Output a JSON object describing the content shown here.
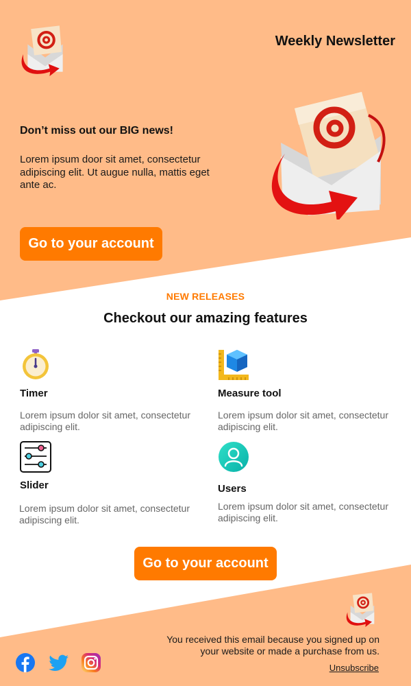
{
  "header": {
    "title": "Weekly Newsletter",
    "logo_icon": "email-at-envelope-icon"
  },
  "hero": {
    "heading": "Don’t miss out our BIG news!",
    "body": "Lorem ipsum door sit amet, consectetur adipiscing elit. Ut augue nulla, mattis eget ante ac.",
    "button_label": "Go to your account",
    "illustration_icon": "email-at-envelope-icon"
  },
  "features": {
    "eyebrow": "NEW RELEASES",
    "title": "Checkout our amazing features",
    "items": [
      {
        "title": "Timer",
        "description": "Lorem ipsum dolor sit amet, consectetur adipiscing elit.",
        "icon": "stopwatch-icon"
      },
      {
        "title": "Measure tool",
        "description": "Lorem ipsum dolor sit amet, consectetur adipiscing elit.",
        "icon": "measure-ruler-icon"
      },
      {
        "title": "Slider",
        "description": "Lorem ipsum dolor sit amet, consectetur adipiscing elit.",
        "icon": "sliders-icon"
      },
      {
        "title": "Users",
        "description": "Lorem ipsum dolor sit amet, consectetur adipiscing elit.",
        "icon": "user-icon"
      }
    ],
    "button_label": "Go to your account"
  },
  "footer": {
    "note": "You received this email because you signed up on your website or made a purchase from us.",
    "unsubscribe_label": "Unsubscribe",
    "social": [
      "facebook-icon",
      "twitter-icon",
      "instagram-icon"
    ]
  },
  "colors": {
    "background_peach": "#ffbb88",
    "accent_orange": "#ff7a00",
    "button_text": "#ffffff",
    "muted_text": "#666666"
  }
}
